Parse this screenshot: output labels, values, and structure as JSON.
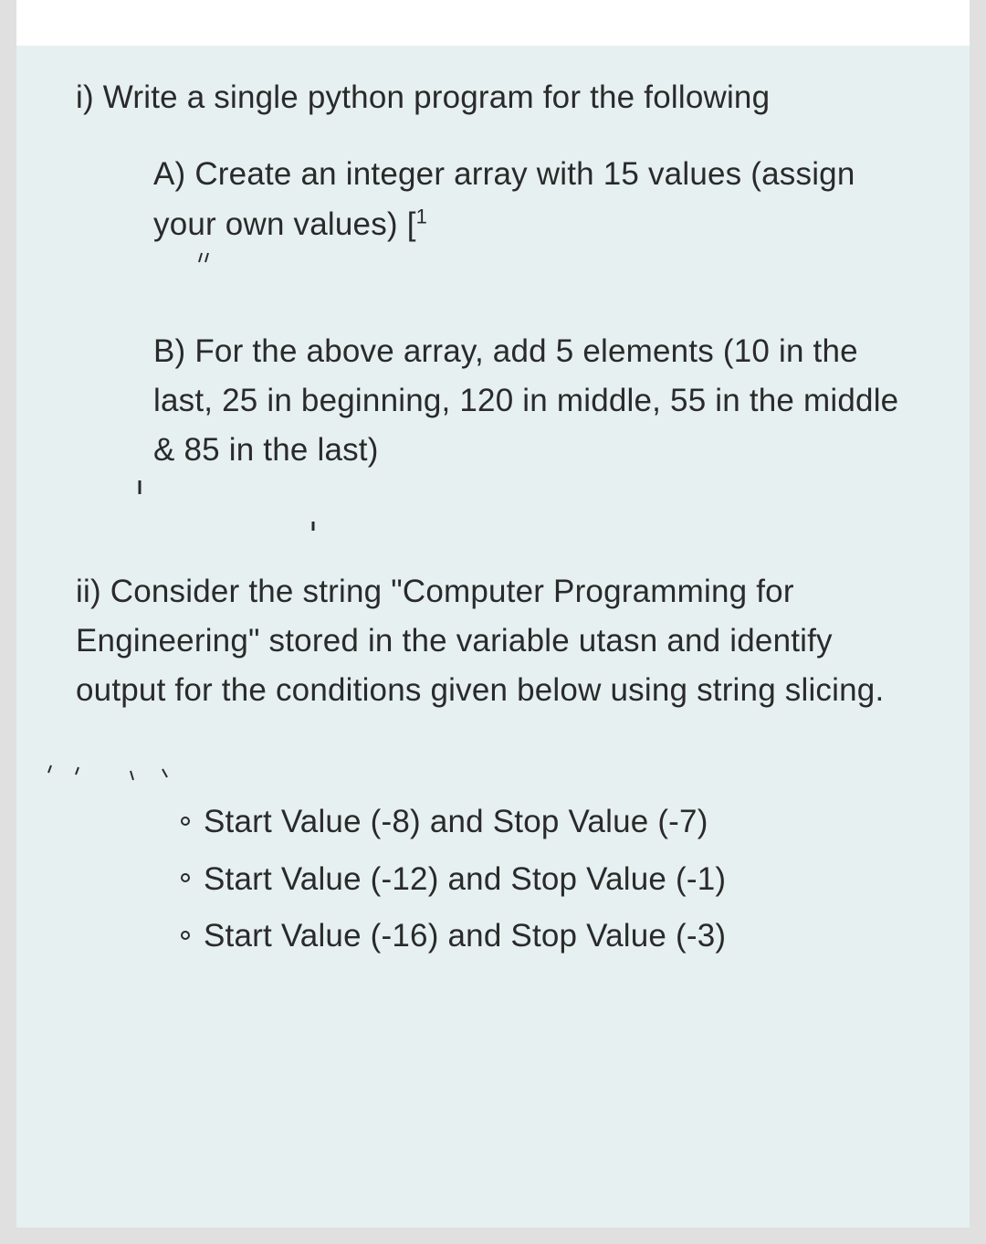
{
  "question1": {
    "intro": "i) Write a single python program for the following",
    "partA": "A) Create an integer array with 15 values (assign your own values) [",
    "partA_tail": "1",
    "partB": "B) For the above array, add 5 elements (10 in the last, 25 in beginning, 120 in middle, 55 in the middle & 85 in the last)"
  },
  "question2": {
    "intro": "ii) Consider the string \"Computer Programming for Engineering\" stored in the variable utasn and identify output for the conditions given below using string slicing.",
    "items": [
      "Start Value (-8) and Stop Value (-7)",
      "Start Value (-12) and Stop Value (-1)",
      "Start Value (-16) and Stop Value (-3)"
    ]
  }
}
